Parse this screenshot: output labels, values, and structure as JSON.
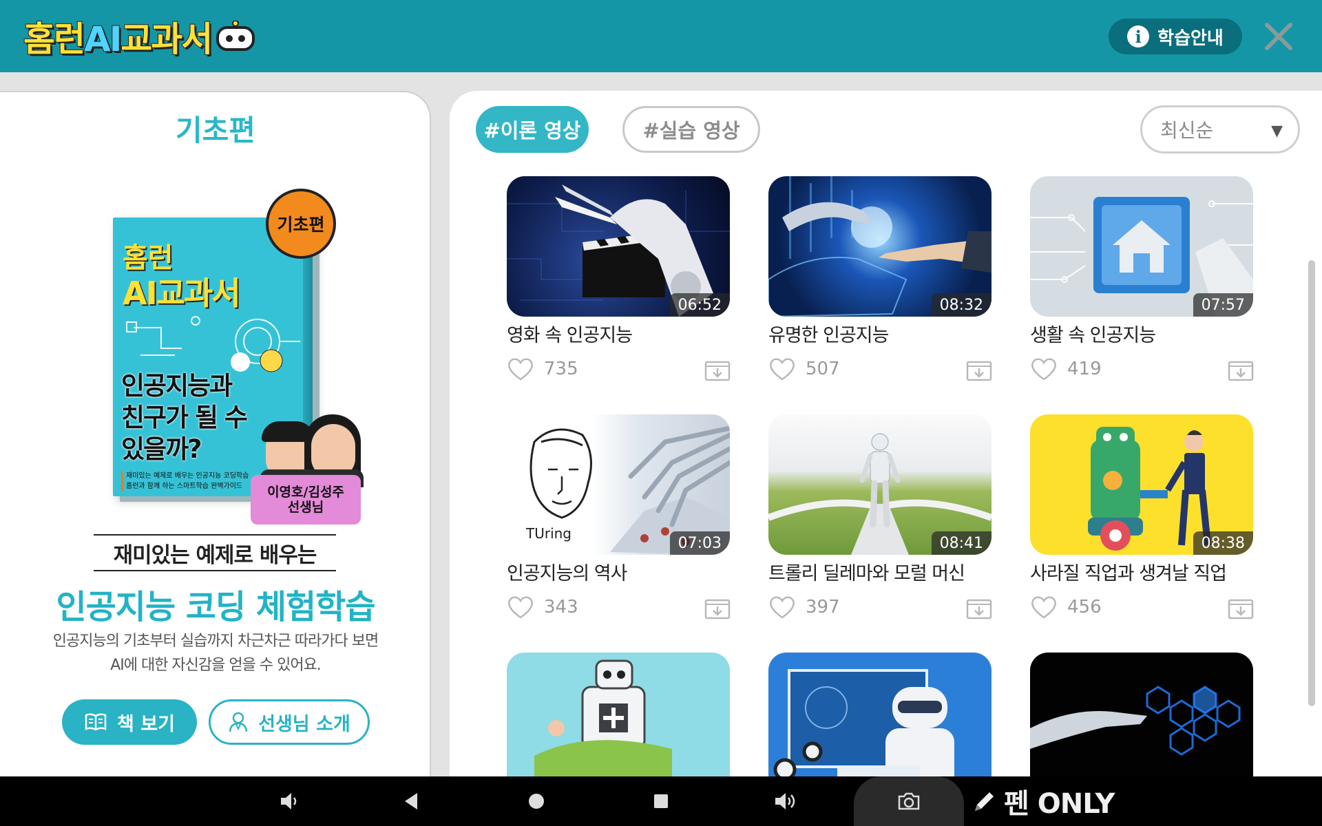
{
  "header": {
    "logo_text_pre": "홈런",
    "logo_text_ai": "AI",
    "logo_text_post": "교과서",
    "help_label": "학습안내"
  },
  "left": {
    "title": "기초편",
    "book": {
      "logo_line1": "홈런",
      "logo_line2": "AI교과서",
      "badge": "기초편",
      "title_line1": "인공지능과",
      "title_line2": "친구가 될 수",
      "title_line3": "있을까?",
      "sub_line1": "재미있는 예제로 배우는 인공지능 코딩학습",
      "sub_line2": "홈런과 함께 하는 스마트학습 완벽가이드",
      "teachers_line1": "이영호/김성주",
      "teachers_line2": "선생님"
    },
    "kicker": "재미있는 예제로 배우는",
    "headline": "인공지능 코딩 체험학습",
    "desc_line1": "인공지능의 기초부터 실습까지 차근차근 따라가다 보면",
    "desc_line2": "AI에 대한 자신감을 얻을 수 있어요.",
    "btn_book": "책 보기",
    "btn_teacher": "선생님 소개"
  },
  "filters": {
    "active": "#이론 영상",
    "inactive": "#실습 영상",
    "sort": "최신순"
  },
  "videos": [
    {
      "title": "영화 속 인공지능",
      "duration": "06:52",
      "likes": "735"
    },
    {
      "title": "유명한 인공지능",
      "duration": "08:32",
      "likes": "507"
    },
    {
      "title": "생활 속 인공지능",
      "duration": "07:57",
      "likes": "419"
    },
    {
      "title": "인공지능의 역사",
      "duration": "07:03",
      "likes": "343"
    },
    {
      "title": "트롤리 딜레마와 모럴 머신",
      "duration": "08:41",
      "likes": "397"
    },
    {
      "title": "사라질 직업과 생겨날 직업",
      "duration": "08:38",
      "likes": "456"
    }
  ],
  "thumb_text": {
    "turing": "TUring"
  },
  "navbar": {
    "pen_only": "펜 ONLY"
  },
  "colors": {
    "header": "#1496a6",
    "accent": "#29b7c9",
    "nav": "#000000"
  }
}
